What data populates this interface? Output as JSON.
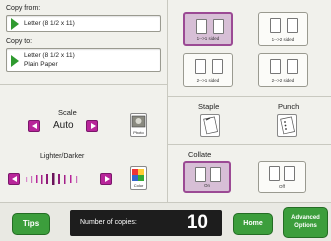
{
  "copy_from": {
    "label": "Copy from:",
    "value": "Letter (8 1/2 x 11)"
  },
  "copy_to": {
    "label": "Copy to:",
    "value_line1": "Letter (8 1/2 x 11)",
    "value_line2": "Plain Paper"
  },
  "scale": {
    "label": "Scale",
    "value": "Auto",
    "photo_label": "Photo"
  },
  "lighter_darker": {
    "label": "Lighter/Darker",
    "color_label": "Color"
  },
  "sided_options": [
    {
      "label": "1-->1 sided",
      "selected": true
    },
    {
      "label": "1-->2 sided",
      "selected": false
    },
    {
      "label": "2-->1 sided",
      "selected": false
    },
    {
      "label": "2-->2 sided",
      "selected": false
    }
  ],
  "staple": {
    "label": "Staple"
  },
  "punch": {
    "label": "Punch"
  },
  "collate": {
    "label": "Collate",
    "on_label": "On",
    "off_label": "Off",
    "selected": "On"
  },
  "bottom_bar": {
    "tips_label": "Tips",
    "copies_label": "Number of copies:",
    "copies_value": "10",
    "home_label": "Home",
    "advanced_label_line1": "Advanced",
    "advanced_label_line2": "Options"
  },
  "colors": {
    "accent_green": "#3c9e3c",
    "magenta": "#b8259a",
    "selected_tile": "#d7bfd6"
  }
}
